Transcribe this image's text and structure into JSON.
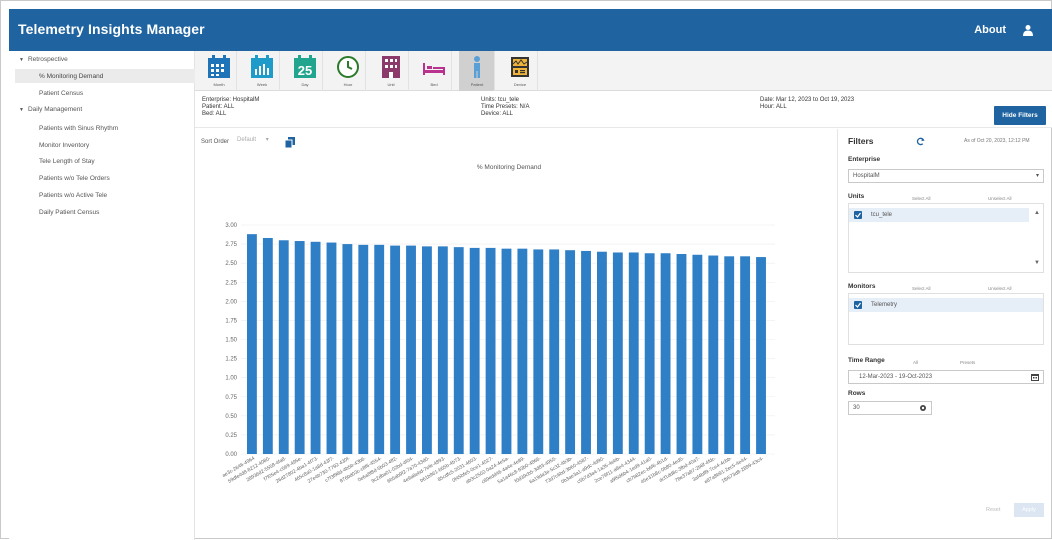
{
  "header": {
    "title": "Telemetry Insights Manager",
    "about": "About",
    "user_icon": "user-icon"
  },
  "sidebar": {
    "groups": [
      {
        "label": "Retrospective",
        "items": [
          "% Monitoring Demand",
          "Patient Census"
        ]
      },
      {
        "label": "Daily Management",
        "items": [
          "Patients with Sinus Rhythm",
          "Monitor Inventory",
          "Tele Length of Stay",
          "Patients w/o Tele Orders",
          "Patients w/o Active Tele",
          "Daily Patient Census"
        ]
      }
    ],
    "active": "% Monitoring Demand"
  },
  "toolbar": {
    "items": [
      {
        "label": "Month",
        "icon": "calendar-month-icon"
      },
      {
        "label": "Week",
        "icon": "calendar-week-icon"
      },
      {
        "label": "Day",
        "icon": "calendar-day-icon",
        "day": "25"
      },
      {
        "label": "Hour",
        "icon": "clock-icon"
      },
      {
        "label": "Unit",
        "icon": "building-icon"
      },
      {
        "label": "Bed",
        "icon": "bed-icon"
      },
      {
        "label": "Patient",
        "icon": "patient-icon"
      },
      {
        "label": "Device",
        "icon": "device-icon"
      }
    ],
    "active": "Patient"
  },
  "info": {
    "enterprise": "Enterprise: HospitalM",
    "patient": "Patient: ALL",
    "bed": "Bed: ALL",
    "units": "Units: tcu_tele",
    "time_presets": "Time Presets: N/A",
    "device": "Device: ALL",
    "date": "Date: Mar 12, 2023 to Oct 19, 2023",
    "hour": "Hour: ALL"
  },
  "hide_filters": "Hide Filters",
  "sort": {
    "label": "Sort Order",
    "value": "Default"
  },
  "chart_data": {
    "type": "bar",
    "title": "% Monitoring Demand",
    "ylim": [
      0,
      3.0
    ],
    "yticks": [
      "0.00",
      "0.25",
      "0.50",
      "0.75",
      "1.00",
      "1.25",
      "1.50",
      "1.75",
      "2.00",
      "2.25",
      "2.50",
      "2.75",
      "3.00"
    ],
    "categories": [
      "ae3c-2646-4964",
      "59dfe4d8-8212-4080-",
      "28936d2-5558-4fa8-",
      "f7f05e4-c569-495e-",
      "26d27802-4ba1-4f73-",
      "465c8a0-1a8d-43f7-",
      "27e4b730-7792-430f-",
      "c7f3f98d-4b5b-43b6-",
      "876bd03c-c8f6-4554-",
      "0e6a8f8d-5b03-4ff2-",
      "9c2dba01-02bd-4f04-",
      "6b5ab9f2-7a70-43d0-",
      "4e9a8ebd-7efe-4893-",
      "b61b961-b55b-4b73-",
      "85cdfc5-2031-4603-",
      "0f45bfe5-0ce1-4027-",
      "ab3c2502-0a24-4e5a-",
      "c89edd46-4a4e-4e89-",
      "5a1a46c8-93b0-4866-",
      "f0d39cb5-3d83-4955-",
      "6a19da3e-5c32-4b3b-",
      "73d7c6bd-3b60-4587-",
      "0b3ae3a1-a9dc-4d90-",
      "c5b7d3a4-1a35-4ebb-",
      "2ce79f11-a8e4-4344-",
      "a9f5d6b4-1ed9-41a0-",
      "cb7b82ec-b6f6-4b1d-",
      "45e31b8c-0b80-4ed5-",
      "dcf1dd8c-3fbd-40a7-",
      "78e37a87-2b8f-4fdc-",
      "3af4bff9-7ce4-4cbb-",
      "e87a8b91-2ec5-4e44-",
      "1fb573d8-2899-43c4-"
    ],
    "values": [
      2.88,
      2.83,
      2.8,
      2.79,
      2.78,
      2.77,
      2.75,
      2.74,
      2.74,
      2.73,
      2.73,
      2.72,
      2.72,
      2.71,
      2.7,
      2.7,
      2.69,
      2.69,
      2.68,
      2.68,
      2.67,
      2.66,
      2.65,
      2.64,
      2.64,
      2.63,
      2.63,
      2.62,
      2.61,
      2.6,
      2.59,
      2.59,
      2.58
    ]
  },
  "filters": {
    "title": "Filters",
    "as_of": "As of Oct 20, 2023, 12:12 PM",
    "enterprise_label": "Enterprise",
    "enterprise_value": "HospitalM",
    "units_label": "Units",
    "select_all": "Select All",
    "unselect_all": "Unselect All",
    "units_item": "tcu_tele",
    "monitors_label": "Monitors",
    "monitors_item": "Telemetry",
    "time_range_label": "Time Range",
    "time_all": "All",
    "time_presets": "Presets",
    "time_range_value": "12-Mar-2023 - 19-Oct-2023",
    "rows_label": "Rows",
    "rows_value": "30",
    "reset": "Reset",
    "apply": "Apply"
  }
}
